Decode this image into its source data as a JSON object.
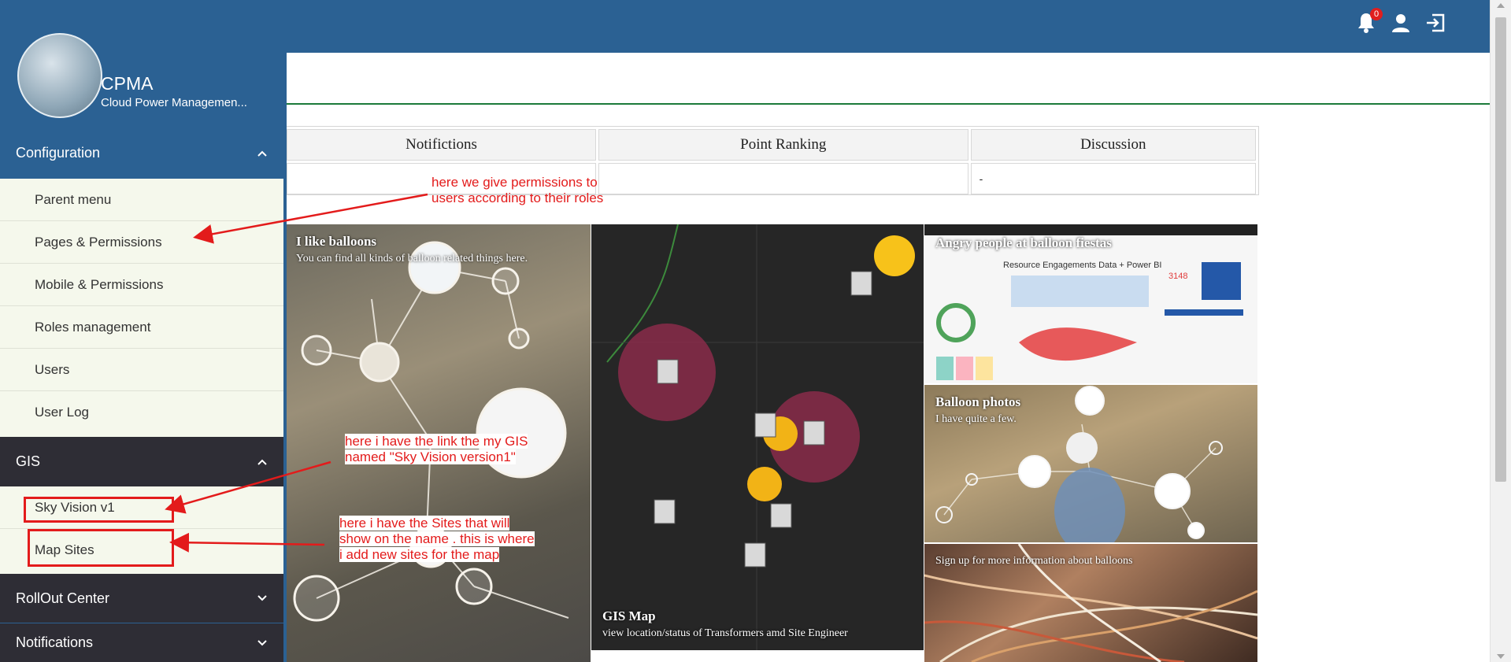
{
  "topbar": {
    "notification_count": "0",
    "icons": [
      "bell-icon",
      "user-icon",
      "logout-icon"
    ]
  },
  "brand": {
    "title": "CPMA",
    "subtitle": "Cloud Power Managemen..."
  },
  "sidebar": {
    "configuration": {
      "label": "Configuration",
      "items": [
        "Parent menu",
        "Pages & Permissions",
        "Mobile & Permissions",
        "Roles management",
        "Users",
        "User Log"
      ]
    },
    "gis": {
      "label": "GIS",
      "items": [
        "Sky Vision v1",
        "Map Sites"
      ]
    },
    "rollout": {
      "label": "RollOut Center"
    },
    "notifications": {
      "label": "Notifications"
    }
  },
  "table": {
    "headers": [
      "Notifictions",
      "Point Ranking",
      "Discussion"
    ],
    "row": [
      "",
      "",
      "-"
    ]
  },
  "tiles": {
    "t1": {
      "title": "I like balloons",
      "subtitle": "You can find all kinds of balloon related things here."
    },
    "t2": {
      "title": "GIS Map",
      "subtitle": "view location/status of Transformers amd Site Engineer"
    },
    "t3": {
      "title": "Angry people at balloon fiestas",
      "inner_title": "Resource Engagements Data + Power BI",
      "inner_value": "3148"
    },
    "t4": {
      "title": "Balloon photos",
      "subtitle": "I have quite a few."
    },
    "t5": {
      "subtitle": "Sign up for more information about balloons"
    }
  },
  "annotations": {
    "a1": [
      "here we give permissions to",
      "users according to their roles"
    ],
    "a2": [
      "here i have the link the my GIS",
      "named \"Sky Vision version1\""
    ],
    "a3": [
      "here i have the Sites that will",
      "show on the name . this is where",
      "i add new sites for the map"
    ]
  },
  "colors": {
    "primary": "#2b6193",
    "dark_section": "#2e2d35",
    "submenu_bg": "#f5f8ec",
    "annotation_red": "#e31b1b",
    "divider_green": "#1c7a3a"
  }
}
